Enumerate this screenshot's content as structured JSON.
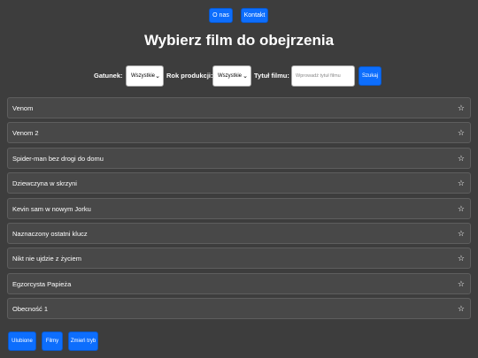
{
  "nav": {
    "about_label": "O nas",
    "contact_label": "Kontakt"
  },
  "page_title": "Wybierz film do obejrzenia",
  "filters": {
    "genre_label": "Gatunek:",
    "genre_value": "Wszystkie",
    "year_label": "Rok produkcji:",
    "year_value": "Wszystkie",
    "title_label": "Tytuł filmu:",
    "title_placeholder": "Wprowadź tytuł filmu",
    "search_label": "Szukaj"
  },
  "movies": [
    {
      "title": "Venom"
    },
    {
      "title": "Venom 2"
    },
    {
      "title": "Spider-man bez drogi do domu"
    },
    {
      "title": "Dziewczyna w skrzyni"
    },
    {
      "title": "Kevin sam w nowym Jorku"
    },
    {
      "title": "Naznaczony ostatni klucz"
    },
    {
      "title": "Nikt nie ujdzie z życiem"
    },
    {
      "title": "Egzorcysta Papieża"
    },
    {
      "title": "Obecność 1"
    }
  ],
  "star_glyph": "☆",
  "bottom": {
    "favorites_label": "Ulubione",
    "films_label": "Filmy",
    "mode_label": "Zmień tryb"
  },
  "colors": {
    "background": "#3d3d3d",
    "accent": "#0d6efd",
    "row_bg": "#484848"
  }
}
